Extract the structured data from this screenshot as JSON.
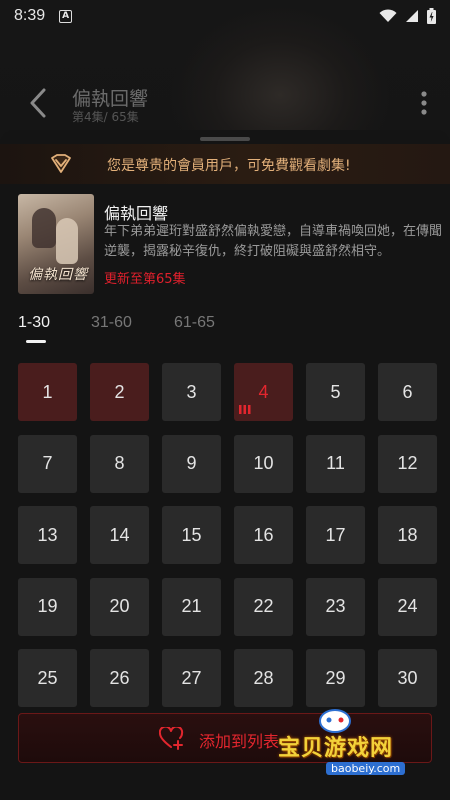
{
  "status_bar": {
    "time": "8:39",
    "app_badge": "A"
  },
  "header": {
    "title": "偏執回響",
    "subtitle": "第4集/ 65集"
  },
  "vip_banner": {
    "text": "您是尊贵的會員用戶，可免費觀看劇集!"
  },
  "drama": {
    "name": "偏執回響",
    "poster_title": "偏執回響",
    "description": "年下弟弟遲珩對盛舒然偏執愛戀，自導車禍喚回她，在傳聞逆襲，揭露秘辛復仇，終打破阻礙與盛舒然相守。",
    "update_text": "更新至第65集"
  },
  "episode_ranges": [
    {
      "label": "1-30",
      "active": true
    },
    {
      "label": "31-60",
      "active": false
    },
    {
      "label": "61-65",
      "active": false
    }
  ],
  "episodes": [
    {
      "num": "1",
      "state": "watched"
    },
    {
      "num": "2",
      "state": "watched"
    },
    {
      "num": "3",
      "state": "normal"
    },
    {
      "num": "4",
      "state": "current"
    },
    {
      "num": "5",
      "state": "normal"
    },
    {
      "num": "6",
      "state": "normal"
    },
    {
      "num": "7",
      "state": "normal"
    },
    {
      "num": "8",
      "state": "normal"
    },
    {
      "num": "9",
      "state": "normal"
    },
    {
      "num": "10",
      "state": "normal"
    },
    {
      "num": "11",
      "state": "normal"
    },
    {
      "num": "12",
      "state": "normal"
    },
    {
      "num": "13",
      "state": "normal"
    },
    {
      "num": "14",
      "state": "normal"
    },
    {
      "num": "15",
      "state": "normal"
    },
    {
      "num": "16",
      "state": "normal"
    },
    {
      "num": "17",
      "state": "normal"
    },
    {
      "num": "18",
      "state": "normal"
    },
    {
      "num": "19",
      "state": "normal"
    },
    {
      "num": "20",
      "state": "normal"
    },
    {
      "num": "21",
      "state": "normal"
    },
    {
      "num": "22",
      "state": "normal"
    },
    {
      "num": "23",
      "state": "normal"
    },
    {
      "num": "24",
      "state": "normal"
    },
    {
      "num": "25",
      "state": "normal"
    },
    {
      "num": "26",
      "state": "normal"
    },
    {
      "num": "27",
      "state": "normal"
    },
    {
      "num": "28",
      "state": "normal"
    },
    {
      "num": "29",
      "state": "normal"
    },
    {
      "num": "30",
      "state": "normal"
    }
  ],
  "add_button": {
    "label": "添加到列表",
    "icon": "heart-plus-icon"
  },
  "watermark": {
    "text": "宝贝游戏网",
    "url": "baobeiy.com"
  },
  "colors": {
    "accent_red": "#e3262e",
    "vip_gold": "#e2b07a",
    "tile_bg": "#2a2a2a",
    "tile_watched_bg": "#4a1d1d"
  }
}
